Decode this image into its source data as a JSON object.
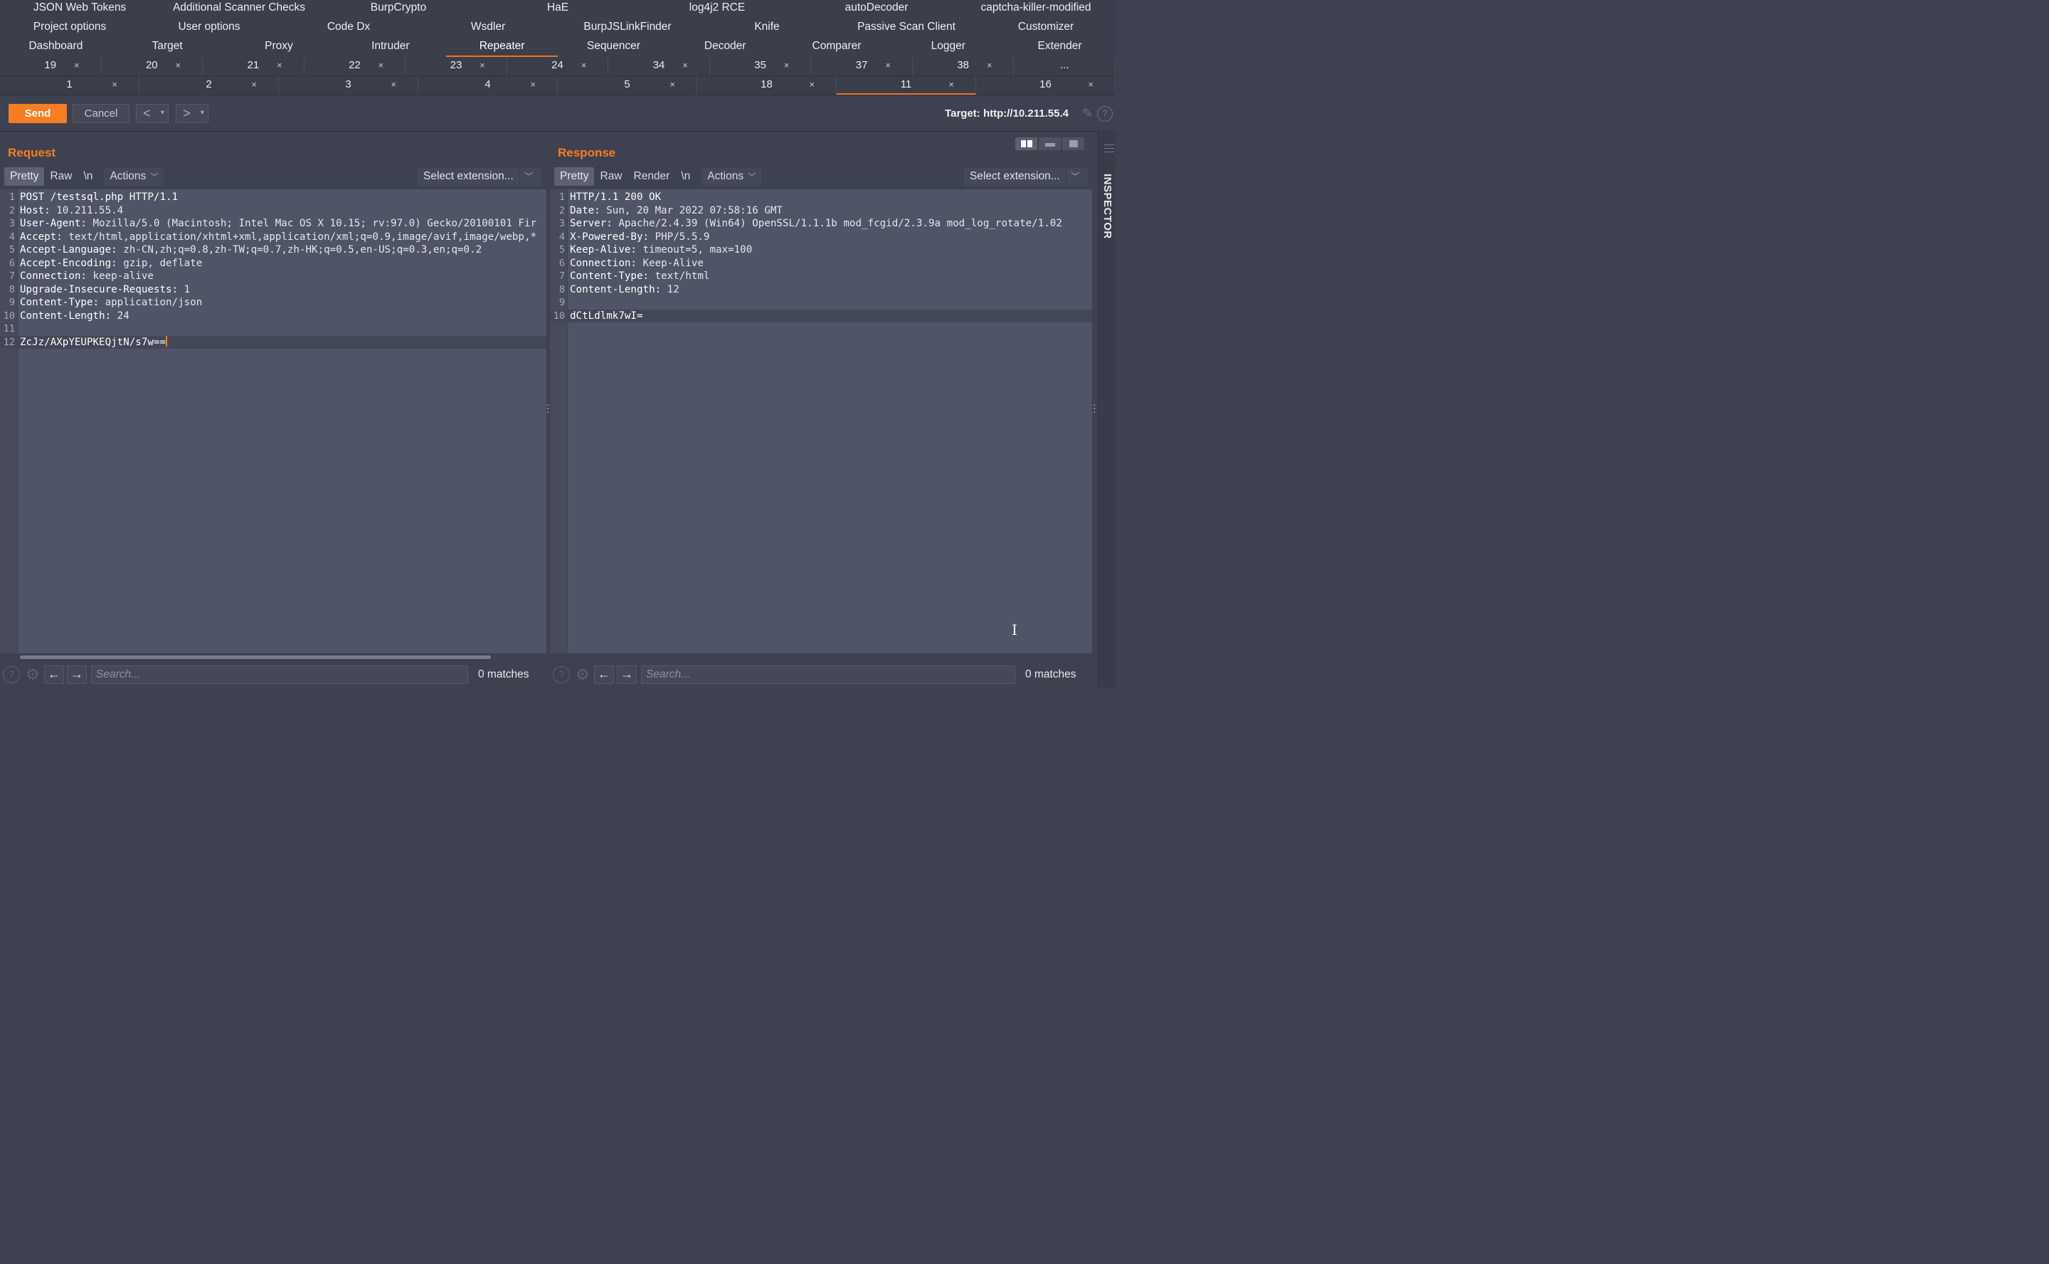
{
  "menu": {
    "row1": [
      "JSON Web Tokens",
      "Additional Scanner Checks",
      "BurpCrypto",
      "HaE",
      "log4j2 RCE",
      "autoDecoder",
      "captcha-killer-modified"
    ],
    "row2": [
      "Project options",
      "User options",
      "Code Dx",
      "Wsdler",
      "BurpJSLinkFinder",
      "Knife",
      "Passive Scan Client",
      "Customizer"
    ],
    "row3": [
      "Dashboard",
      "Target",
      "Proxy",
      "Intruder",
      "Repeater",
      "Sequencer",
      "Decoder",
      "Comparer",
      "Logger",
      "Extender"
    ],
    "active": "Repeater"
  },
  "repeater_tabs": {
    "row1": [
      "19",
      "20",
      "21",
      "22",
      "23",
      "24",
      "34",
      "35",
      "37",
      "38",
      "..."
    ],
    "row2": [
      "1",
      "2",
      "3",
      "4",
      "5",
      "18",
      "11",
      "16"
    ],
    "active": "11",
    "close_glyph": "×"
  },
  "toolbar": {
    "send_label": "Send",
    "cancel_label": "Cancel",
    "back_glyph": "<",
    "forward_glyph": ">",
    "dropdown_glyph": "▾",
    "target": "Target: http://10.211.55.4"
  },
  "request": {
    "title": "Request",
    "views": [
      "Pretty",
      "Raw",
      "\\n"
    ],
    "actions_label": "Actions",
    "select_extension": "Select extension...",
    "lines": [
      {
        "n": "1",
        "h": "POST /testsql.php HTTP/1.1",
        "v": ""
      },
      {
        "n": "2",
        "h": "Host:",
        "v": " 10.211.55.4"
      },
      {
        "n": "3",
        "h": "User-Agent:",
        "v": " Mozilla/5.0 (Macintosh; Intel Mac OS X 10.15; rv:97.0) Gecko/20100101 Fir"
      },
      {
        "n": "4",
        "h": "Accept:",
        "v": " text/html,application/xhtml+xml,application/xml;q=0.9,image/avif,image/webp,*"
      },
      {
        "n": "5",
        "h": "Accept-Language:",
        "v": " zh-CN,zh;q=0.8,zh-TW;q=0.7,zh-HK;q=0.5,en-US;q=0.3,en;q=0.2"
      },
      {
        "n": "6",
        "h": "Accept-Encoding:",
        "v": " gzip, deflate"
      },
      {
        "n": "7",
        "h": "Connection:",
        "v": " keep-alive"
      },
      {
        "n": "8",
        "h": "Upgrade-Insecure-Requests:",
        "v": " 1"
      },
      {
        "n": "9",
        "h": "Content-Type:",
        "v": " application/json"
      },
      {
        "n": "10",
        "h": "Content-Length:",
        "v": " 24"
      },
      {
        "n": "11",
        "h": "",
        "v": ""
      },
      {
        "n": "12",
        "h": "ZcJz/AXpYEUPKEQjtN/s7w==",
        "v": ""
      }
    ],
    "search_placeholder": "Search...",
    "matches": "0 matches"
  },
  "response": {
    "title": "Response",
    "views": [
      "Pretty",
      "Raw",
      "Render",
      "\\n"
    ],
    "actions_label": "Actions",
    "select_extension": "Select extension...",
    "lines": [
      {
        "n": "1",
        "h": "HTTP/1.1 200 OK",
        "v": ""
      },
      {
        "n": "2",
        "h": "Date:",
        "v": " Sun, 20 Mar 2022 07:58:16 GMT"
      },
      {
        "n": "3",
        "h": "Server:",
        "v": " Apache/2.4.39 (Win64) OpenSSL/1.1.1b mod_fcgid/2.3.9a mod_log_rotate/1.02"
      },
      {
        "n": "4",
        "h": "X-Powered-By:",
        "v": " PHP/5.5.9"
      },
      {
        "n": "5",
        "h": "Keep-Alive:",
        "v": " timeout=5, max=100"
      },
      {
        "n": "6",
        "h": "Connection:",
        "v": " Keep-Alive"
      },
      {
        "n": "7",
        "h": "Content-Type:",
        "v": " text/html"
      },
      {
        "n": "8",
        "h": "Content-Length:",
        "v": " 12"
      },
      {
        "n": "9",
        "h": "",
        "v": ""
      },
      {
        "n": "10",
        "h": "dCtLdlmk7wI=",
        "v": ""
      }
    ],
    "search_placeholder": "Search...",
    "matches": "0 matches"
  },
  "inspector": {
    "label": "INSPECTOR"
  },
  "colors": {
    "accent": "#f77d22",
    "background": "#3e4250",
    "editor": "#4f5466"
  },
  "icons": [
    "help-icon",
    "gear-icon",
    "arrow-left-icon",
    "arrow-right-icon",
    "edit-icon",
    "layout-icon",
    "chevron-down-icon",
    "close-icon",
    "ibeam-cursor-icon"
  ]
}
